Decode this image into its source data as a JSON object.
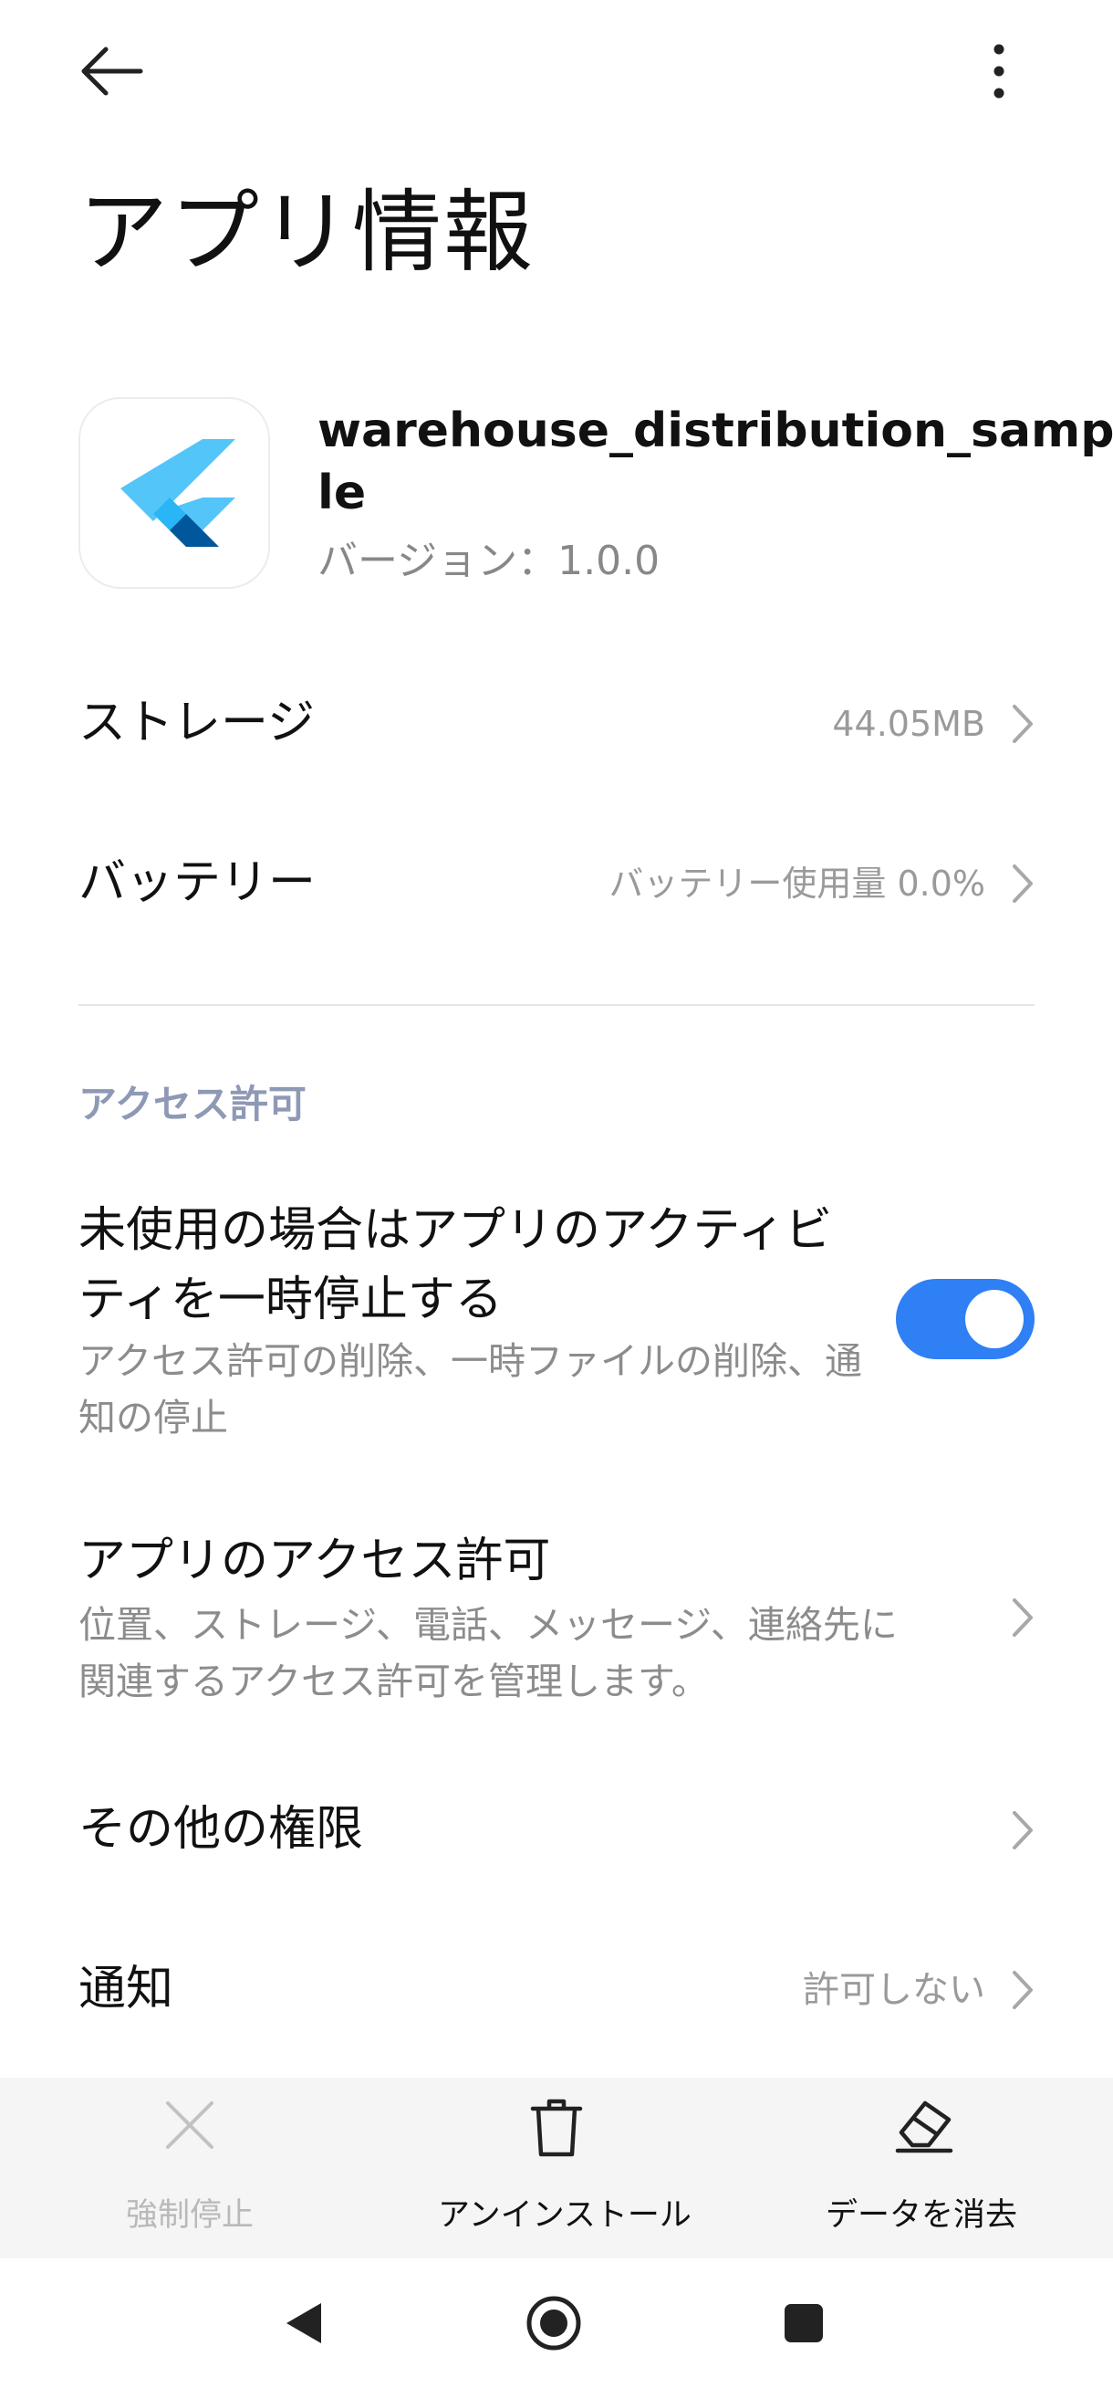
{
  "header": {
    "back_icon": "arrow-left-icon",
    "more_icon": "more-vertical-icon",
    "title": "アプリ情報"
  },
  "app": {
    "icon": "flutter-logo-icon",
    "name": "warehouse_distribution_sample",
    "version": "バージョン：1.0.0"
  },
  "rows": {
    "storage": {
      "title": "ストレージ",
      "value": "44.05MB"
    },
    "battery": {
      "title": "バッテリー",
      "value": "バッテリー使用量 0.0%"
    }
  },
  "permissions": {
    "section_title": "アクセス許可",
    "pause_activity": {
      "title": "未使用の場合はアプリのアクティビティを一時停止する",
      "subtitle": "アクセス許可の削除、一時ファイルの削除、通知の停止",
      "enabled": true
    },
    "app_permissions": {
      "title": "アプリのアクセス許可",
      "subtitle": "位置、ストレージ、電話、メッセージ、連絡先に関連するアクセス許可を管理します。"
    },
    "other_permissions": {
      "title": "その他の権限"
    },
    "notifications": {
      "title": "通知",
      "value": "許可しない"
    }
  },
  "actions": {
    "force_stop": {
      "label": "強制停止",
      "icon": "close-x-icon",
      "enabled": false
    },
    "uninstall": {
      "label": "アンインストール",
      "icon": "trash-icon",
      "enabled": true
    },
    "clear_data": {
      "label": "データを消去",
      "icon": "eraser-icon",
      "enabled": true
    }
  },
  "navbar": {
    "back_icon": "nav-back-triangle-icon",
    "home_icon": "nav-home-circle-icon",
    "recents_icon": "nav-recents-square-icon"
  },
  "colors": {
    "accent": "#2f7ff5",
    "section_label": "#8e99b5",
    "secondary_text": "#9a9a9a",
    "action_bar_bg": "#f5f5f5"
  }
}
